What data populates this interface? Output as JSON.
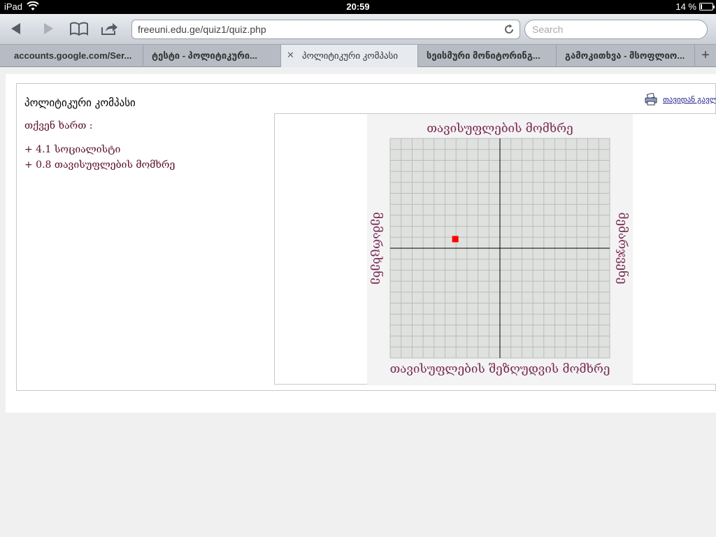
{
  "status_bar": {
    "carrier": "iPad",
    "time": "20:59",
    "battery_text": "14 %",
    "battery_level": 0.14
  },
  "toolbar": {
    "url": "freeuni.edu.ge/quiz1/quiz.php",
    "search_placeholder": "Search"
  },
  "tabs": [
    {
      "label": "accounts.google.com/Ser..."
    },
    {
      "label": "ტესტი - პოლიტიკური..."
    },
    {
      "label": "პოლიტიკური კომპასი",
      "active": true
    },
    {
      "label": "სეისმური მონიტორინგ..."
    },
    {
      "label": "გამოკითხვა - მსოფლიო..."
    }
  ],
  "page": {
    "title": "პოლიტიკური კომპასი",
    "you_are": "თქვენ ხართ :",
    "scores": [
      "+ 4.1 სოციალისტი",
      "+ 0.8 თავისუფლების მომხრე"
    ],
    "restart_link": "თავიდან გავლა"
  },
  "chart_data": {
    "type": "scatter",
    "top_label": "თავისუფლების მომხრე",
    "bottom_label": "თავისუფლების შეზღუდვის მომხრე",
    "left_label": "მემარცხენე",
    "right_label": "მემარჯვენე",
    "xlim": [
      -10,
      10
    ],
    "ylim": [
      -10,
      10
    ],
    "grid_divisions": 20,
    "grid": true,
    "points": [
      {
        "x": -4.1,
        "y": 0.8
      }
    ],
    "colors": {
      "grid_bg": "#dfe1df",
      "grid_line": "#b9bdb9",
      "axis": "#000000",
      "label": "#7a2a55",
      "marker": "#ff0000"
    }
  }
}
